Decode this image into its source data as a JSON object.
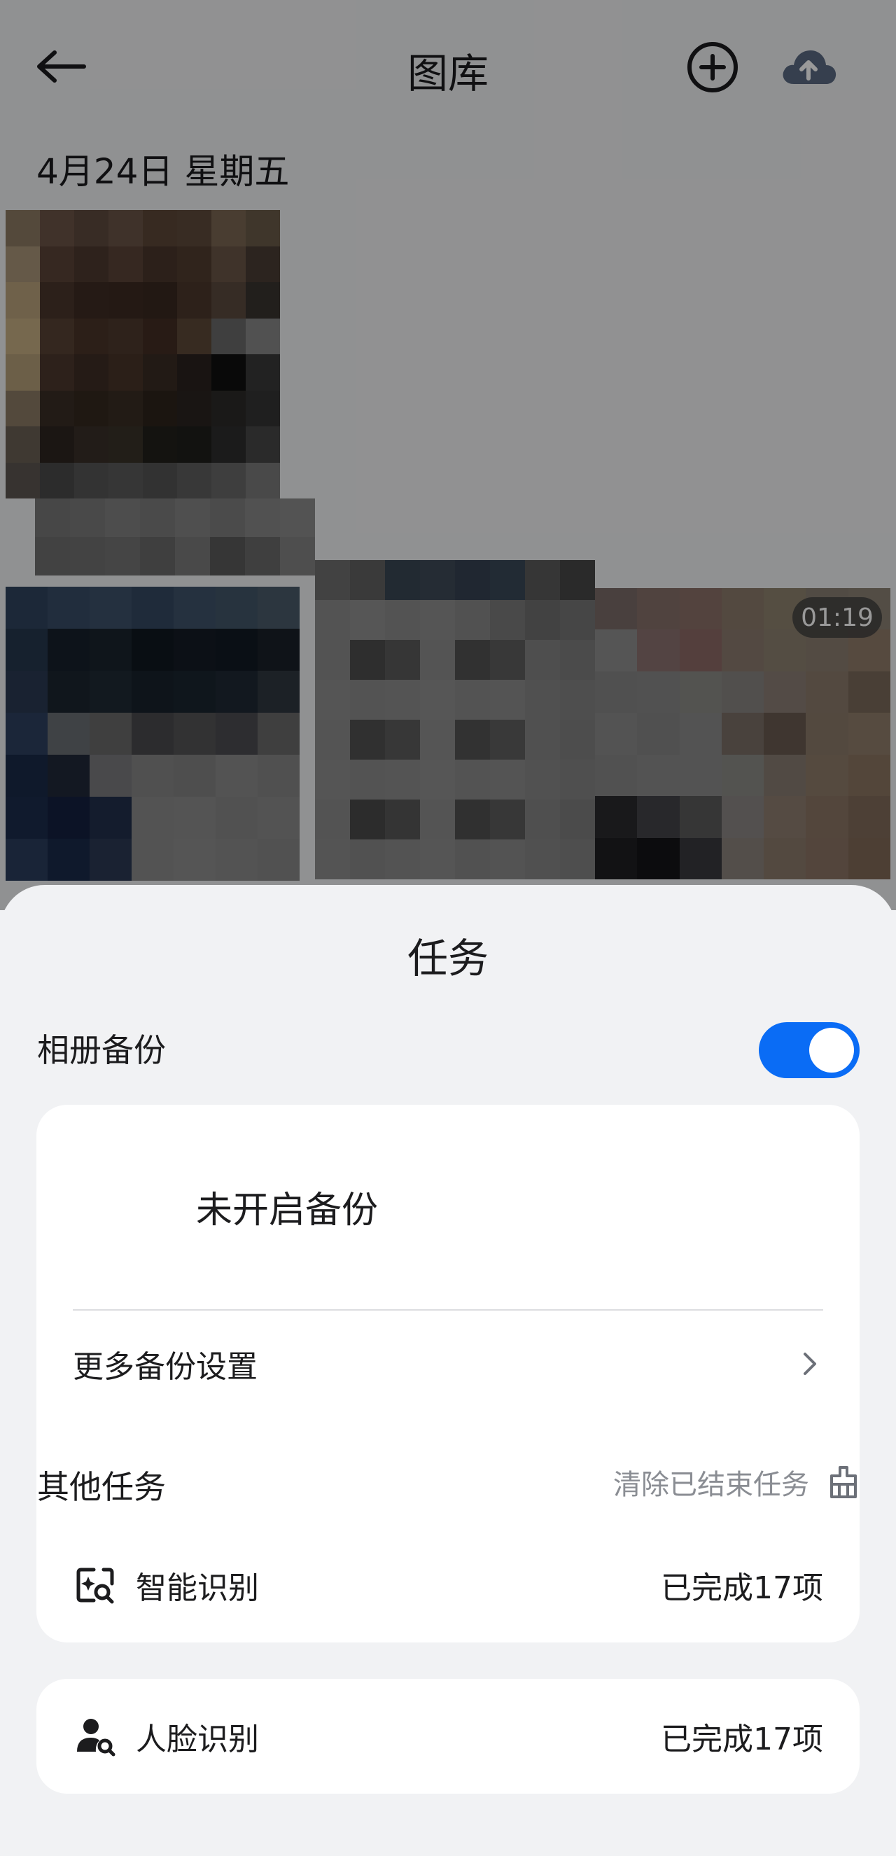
{
  "header": {
    "title": "图库",
    "back_icon": "arrow-left-icon",
    "add_icon": "plus-circle-icon",
    "upload_icon": "cloud-upload-icon"
  },
  "gallery": {
    "date": "4月24日 星期五",
    "video_duration": "01:19"
  },
  "sheet": {
    "title": "任务",
    "album_backup": {
      "label": "相册备份",
      "toggle_on": true,
      "status": "未开启备份",
      "more_settings": "更多备份设置"
    },
    "other_tasks": {
      "label": "其他任务",
      "clear_label": "清除已结束任务",
      "items": [
        {
          "name": "智能识别",
          "status": "已完成17项",
          "icon": "smart-recognition-icon"
        },
        {
          "name": "人脸识别",
          "status": "已完成17项",
          "icon": "face-recognition-icon"
        }
      ]
    }
  },
  "colors": {
    "accent": "#0a6cf5",
    "sheet_bg": "#f1f2f4",
    "card_bg": "#ffffff",
    "secondary_text": "#8a8d93"
  }
}
